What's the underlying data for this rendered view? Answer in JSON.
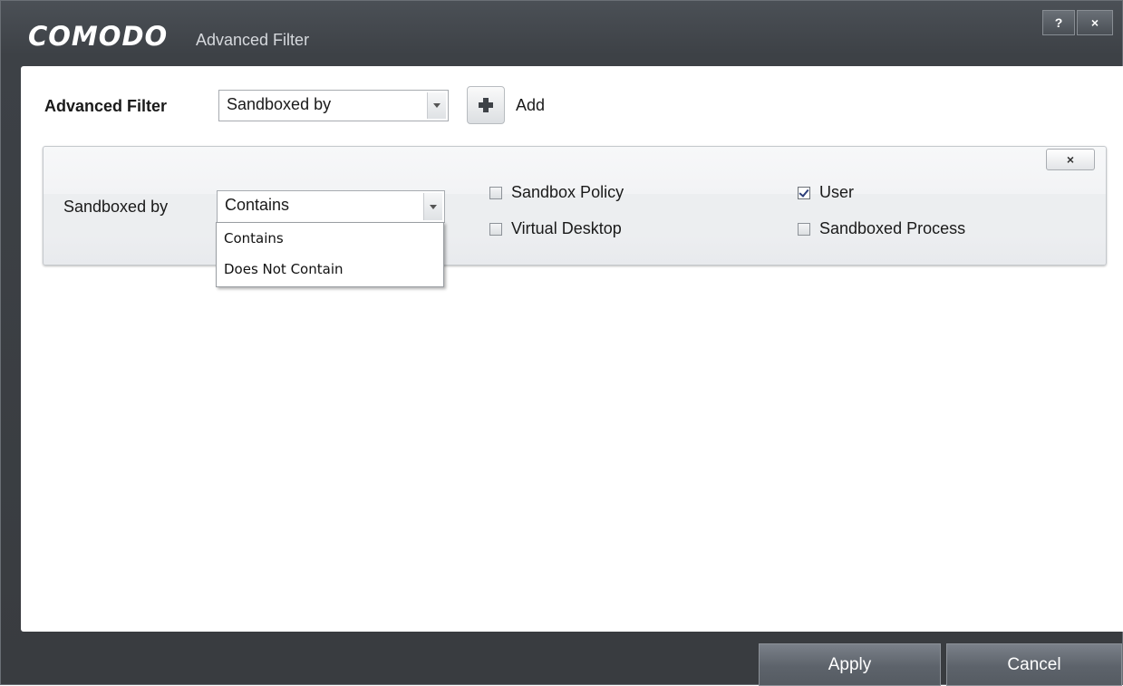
{
  "window": {
    "brand": "COMODO",
    "title": "Advanced Filter",
    "help_label": "?",
    "close_label": "×"
  },
  "filter_bar": {
    "label": "Advanced Filter",
    "selected": "Sandboxed by",
    "add_label": "Add"
  },
  "filter_row": {
    "label": "Sandboxed by",
    "close_label": "×",
    "condition": {
      "selected": "Contains",
      "options": [
        "Contains",
        "Does Not Contain"
      ]
    },
    "checkboxes": [
      {
        "label": "Sandbox Policy",
        "checked": false
      },
      {
        "label": "User",
        "checked": true
      },
      {
        "label": "Virtual Desktop",
        "checked": false
      },
      {
        "label": "Sandboxed Process",
        "checked": false
      }
    ]
  },
  "footer": {
    "apply_label": "Apply",
    "cancel_label": "Cancel"
  }
}
